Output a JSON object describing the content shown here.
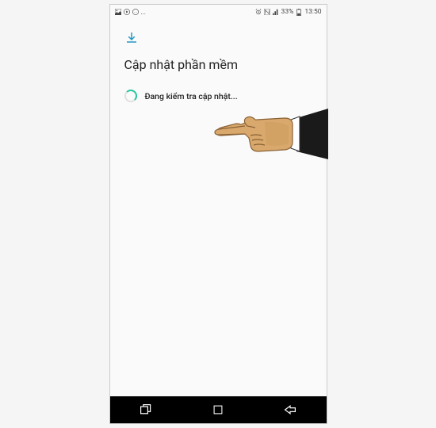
{
  "status_bar": {
    "left_icons": [
      "image-icon",
      "play-icon",
      "more-icon"
    ],
    "right_text": "33%",
    "time": "13:50"
  },
  "screen": {
    "title": "Cập nhật phần mềm",
    "checking_text": "Đang kiểm tra cập nhật..."
  },
  "nav": {
    "recents": "recents",
    "home": "home",
    "back": "back"
  }
}
